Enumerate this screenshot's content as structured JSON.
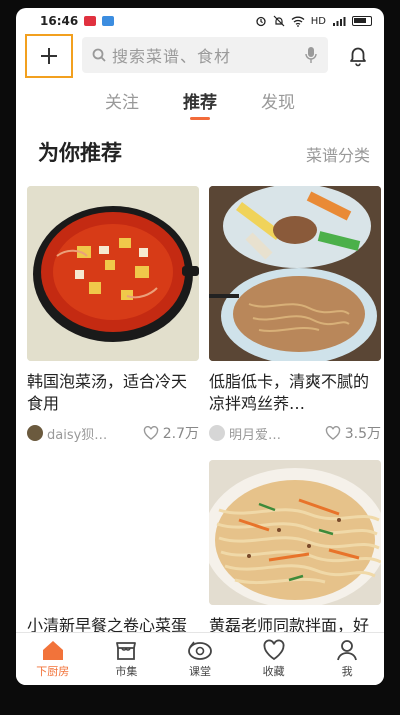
{
  "status": {
    "time": "16:46",
    "network": "HD"
  },
  "search": {
    "placeholder": "搜索菜谱、食材"
  },
  "tabs": [
    {
      "label": "关注",
      "active": false
    },
    {
      "label": "推荐",
      "active": true
    },
    {
      "label": "发现",
      "active": false
    }
  ],
  "section": {
    "title": "为你推荐",
    "link": "菜谱分类"
  },
  "cards": [
    {
      "title": "韩国泡菜汤，适合冷天食用",
      "author": "daisy狈…",
      "likes": "2.7万",
      "image": "kimchi-soup-photo"
    },
    {
      "title": "低脂低卡，清爽不腻的凉拌鸡丝荞…",
      "author": "明月爱…",
      "likes": "3.5万",
      "image": "chicken-buckwheat-noodles-photo"
    },
    {
      "title": "小清新早餐之卷心菜蛋饼",
      "author": "",
      "likes": "",
      "image": "breakfast-photo"
    },
    {
      "title": "黄磊老师同款拌面，好吃到舔盘",
      "author": "",
      "likes": "",
      "image": "mixed-noodles-photo"
    }
  ],
  "nav": [
    {
      "label": "下厨房",
      "icon": "home-icon",
      "active": true
    },
    {
      "label": "市集",
      "icon": "market-icon",
      "active": false
    },
    {
      "label": "课堂",
      "icon": "classroom-icon",
      "active": false
    },
    {
      "label": "收藏",
      "icon": "heart-icon",
      "active": false
    },
    {
      "label": "我",
      "icon": "profile-icon",
      "active": false
    }
  ],
  "colors": {
    "accent": "#f2733a",
    "add_border": "#f2a01f",
    "search_bg": "#f1f1f1"
  }
}
